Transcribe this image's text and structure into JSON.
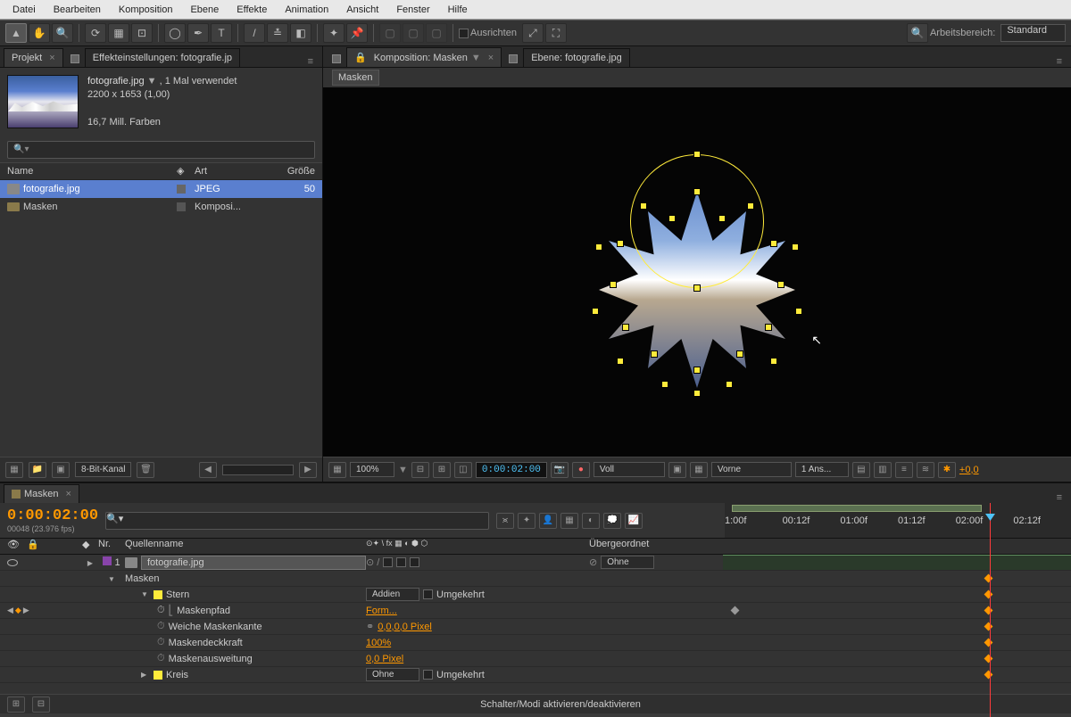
{
  "menu": [
    "Datei",
    "Bearbeiten",
    "Komposition",
    "Ebene",
    "Effekte",
    "Animation",
    "Ansicht",
    "Fenster",
    "Hilfe"
  ],
  "toolbar": {
    "align_label": "Ausrichten",
    "workspace_label": "Arbeitsbereich:",
    "workspace_value": "Standard"
  },
  "project": {
    "tab": "Projekt",
    "effects_tab": "Effekteinstellungen: fotografie.jp",
    "filename": "fotografie.jpg",
    "used": ", 1 Mal verwendet",
    "dims": "2200 x 1653 (1,00)",
    "colors": "16,7 Mill. Farben",
    "cols": {
      "name": "Name",
      "type": "Art",
      "size": "Größe"
    },
    "rows": [
      {
        "name": "fotografie.jpg",
        "type": "JPEG",
        "size": "50",
        "sel": true,
        "icon": "file"
      },
      {
        "name": "Masken",
        "type": "Komposi...",
        "size": "",
        "sel": false,
        "icon": "folder"
      }
    ],
    "bit": "8-Bit-Kanal"
  },
  "comp": {
    "tab": "Komposition: Masken",
    "layer_tab": "Ebene: fotografie.jpg",
    "crumb": "Masken",
    "zoom": "100%",
    "time": "0:00:02:00",
    "view": "Voll",
    "camera": "Vorne",
    "views": "1 Ans...",
    "exposure": "+0,0"
  },
  "timeline": {
    "tab": "Masken",
    "time": "0:00:02:00",
    "frames": "00048 (23.976 fps)",
    "col_nr": "Nr.",
    "col_src": "Quellenname",
    "col_parent": "Übergeordnet",
    "ruler": [
      "1:00f",
      "00:12f",
      "01:00f",
      "01:12f",
      "02:00f",
      "02:12f"
    ],
    "layer": {
      "num": "1",
      "name": "fotografie.jpg",
      "parent": "Ohne",
      "group": "Masken",
      "masks": [
        {
          "name": "Stern",
          "mode": "Addien",
          "inverted": "Umgekehrt",
          "props": [
            {
              "name": "Maskenpfad",
              "value": "Form...",
              "animated": true,
              "kf": true
            },
            {
              "name": "Weiche Maskenkante",
              "value": "0,0,0,0 Pixel",
              "link": true
            },
            {
              "name": "Maskendeckkraft",
              "value": "100%"
            },
            {
              "name": "Maskenausweitung",
              "value": "0,0 Pixel"
            }
          ]
        },
        {
          "name": "Kreis",
          "mode": "Ohne",
          "inverted": "Umgekehrt"
        }
      ]
    },
    "toggle": "Schalter/Modi aktivieren/deaktivieren"
  }
}
